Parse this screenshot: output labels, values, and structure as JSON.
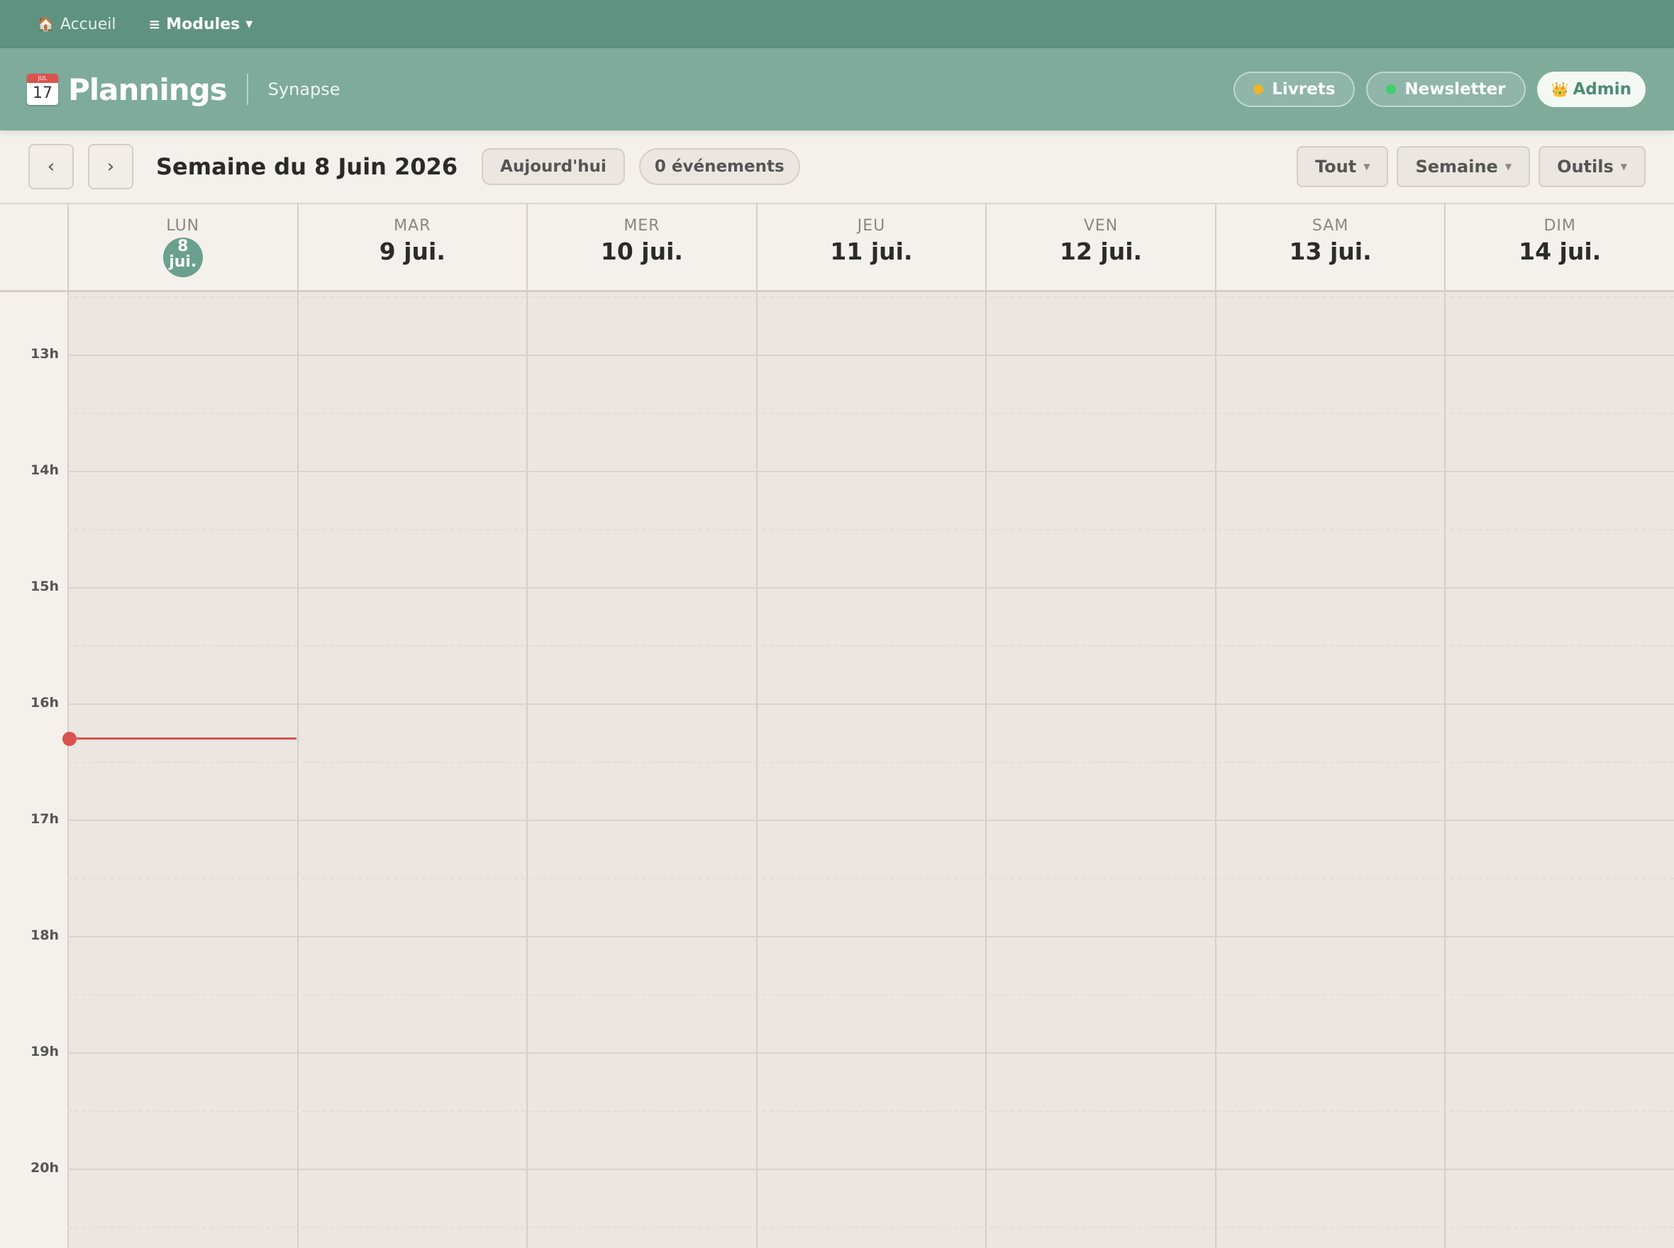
{
  "topnav": {
    "home_label": "Accueil",
    "home_icon": "house-icon",
    "modules_label": "Modules",
    "modules_icon": "menu-icon"
  },
  "header": {
    "calendar_icon_month": "JUL",
    "calendar_icon_day": "17",
    "title": "Plannings",
    "subtitle": "Synapse",
    "pills": [
      {
        "label": "Livrets",
        "dot_color": "#f0b429"
      },
      {
        "label": "Newsletter",
        "dot_color": "#3ecf6e"
      },
      {
        "label": "Admin",
        "icon": "crown-icon"
      }
    ]
  },
  "toolbar": {
    "prev_label": "‹",
    "next_label": "›",
    "week_title": "Semaine du 8 Juin 2026",
    "today_label": "Aujourd'hui",
    "events_count": "0 événements",
    "filter_label": "Tout",
    "view_label": "Semaine",
    "tools_label": "Outils"
  },
  "days": [
    {
      "name": "LUN",
      "date_num": "8",
      "date_month": "jui.",
      "today": true
    },
    {
      "name": "MAR",
      "date": "9 jui."
    },
    {
      "name": "MER",
      "date": "10 jui."
    },
    {
      "name": "JEU",
      "date": "11 jui."
    },
    {
      "name": "VEN",
      "date": "12 jui."
    },
    {
      "name": "SAM",
      "date": "13 jui."
    },
    {
      "name": "DIM",
      "date": "14 jui."
    }
  ],
  "hours": [
    "13h",
    "14h",
    "15h",
    "16h",
    "17h",
    "18h",
    "19h",
    "20h"
  ],
  "colors": {
    "brand": "#5e9281",
    "header": "#7eab9b",
    "now_indicator": "#d9534f",
    "today": "#6aa08e"
  }
}
